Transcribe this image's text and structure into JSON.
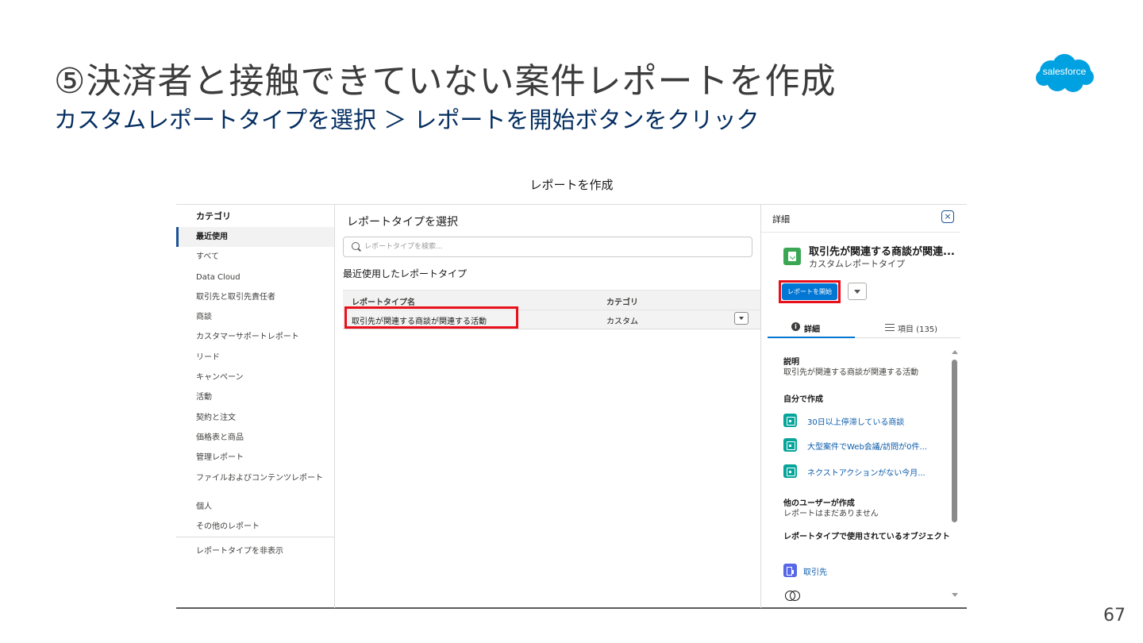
{
  "slide": {
    "title": "⑤決済者と接触できていない案件レポートを作成",
    "subtitle": "カスタムレポートタイプを選択 ＞ レポートを開始ボタンをクリック",
    "logo_text": "salesforce",
    "page_number": "67",
    "brand_color": "#00a1e0",
    "subtitle_color": "#032d60",
    "highlight_color": "#e8101b"
  },
  "modal": {
    "title": "レポートを作成",
    "categories": {
      "heading": "カテゴリ",
      "items": [
        {
          "label": "最近使用",
          "selected": true
        },
        {
          "label": "すべて"
        },
        {
          "label": "Data Cloud"
        },
        {
          "label": "取引先と取引先責任者"
        },
        {
          "label": "商談"
        },
        {
          "label": "カスタマーサポートレポート"
        },
        {
          "label": "リード"
        },
        {
          "label": "キャンペーン"
        },
        {
          "label": "活動"
        },
        {
          "label": "契約と注文"
        },
        {
          "label": "価格表と商品"
        },
        {
          "label": "管理レポート"
        },
        {
          "label": "ファイルおよびコンテンツレポート"
        },
        {
          "label": "個人"
        },
        {
          "label": "その他のレポート"
        }
      ],
      "hide_label": "レポートタイプを非表示"
    },
    "middle": {
      "heading": "レポートタイプを選択",
      "search_placeholder": "レポートタイプを検索...",
      "recent_heading": "最近使用したレポートタイプ",
      "columns": [
        "レポートタイプ名",
        "カテゴリ"
      ],
      "rows": [
        {
          "name": "取引先が関連する商談が関連する活動",
          "category": "カスタム"
        }
      ]
    },
    "details": {
      "heading": "詳細",
      "close_label": "×",
      "report_type_name": "取引先が関連する商談が関連...",
      "report_type_kind": "カスタムレポートタイプ",
      "start_button": "レポートを開始",
      "tabs": {
        "details": "詳細",
        "fields": "項目 (135)"
      },
      "description_label": "説明",
      "description": "取引先が関連する商談が関連する活動",
      "created_by_me_label": "自分で作成",
      "my_reports": [
        "30日以上停滞している商談",
        "大型案件でWeb会議/訪問が0件...",
        "ネクストアクションがない今月..."
      ],
      "other_users_label": "他のユーザーが作成",
      "other_users_text": "レポートはまだありません",
      "objects_label": "レポートタイプで使用されているオブジェクト",
      "objects": [
        "取引先"
      ]
    }
  }
}
